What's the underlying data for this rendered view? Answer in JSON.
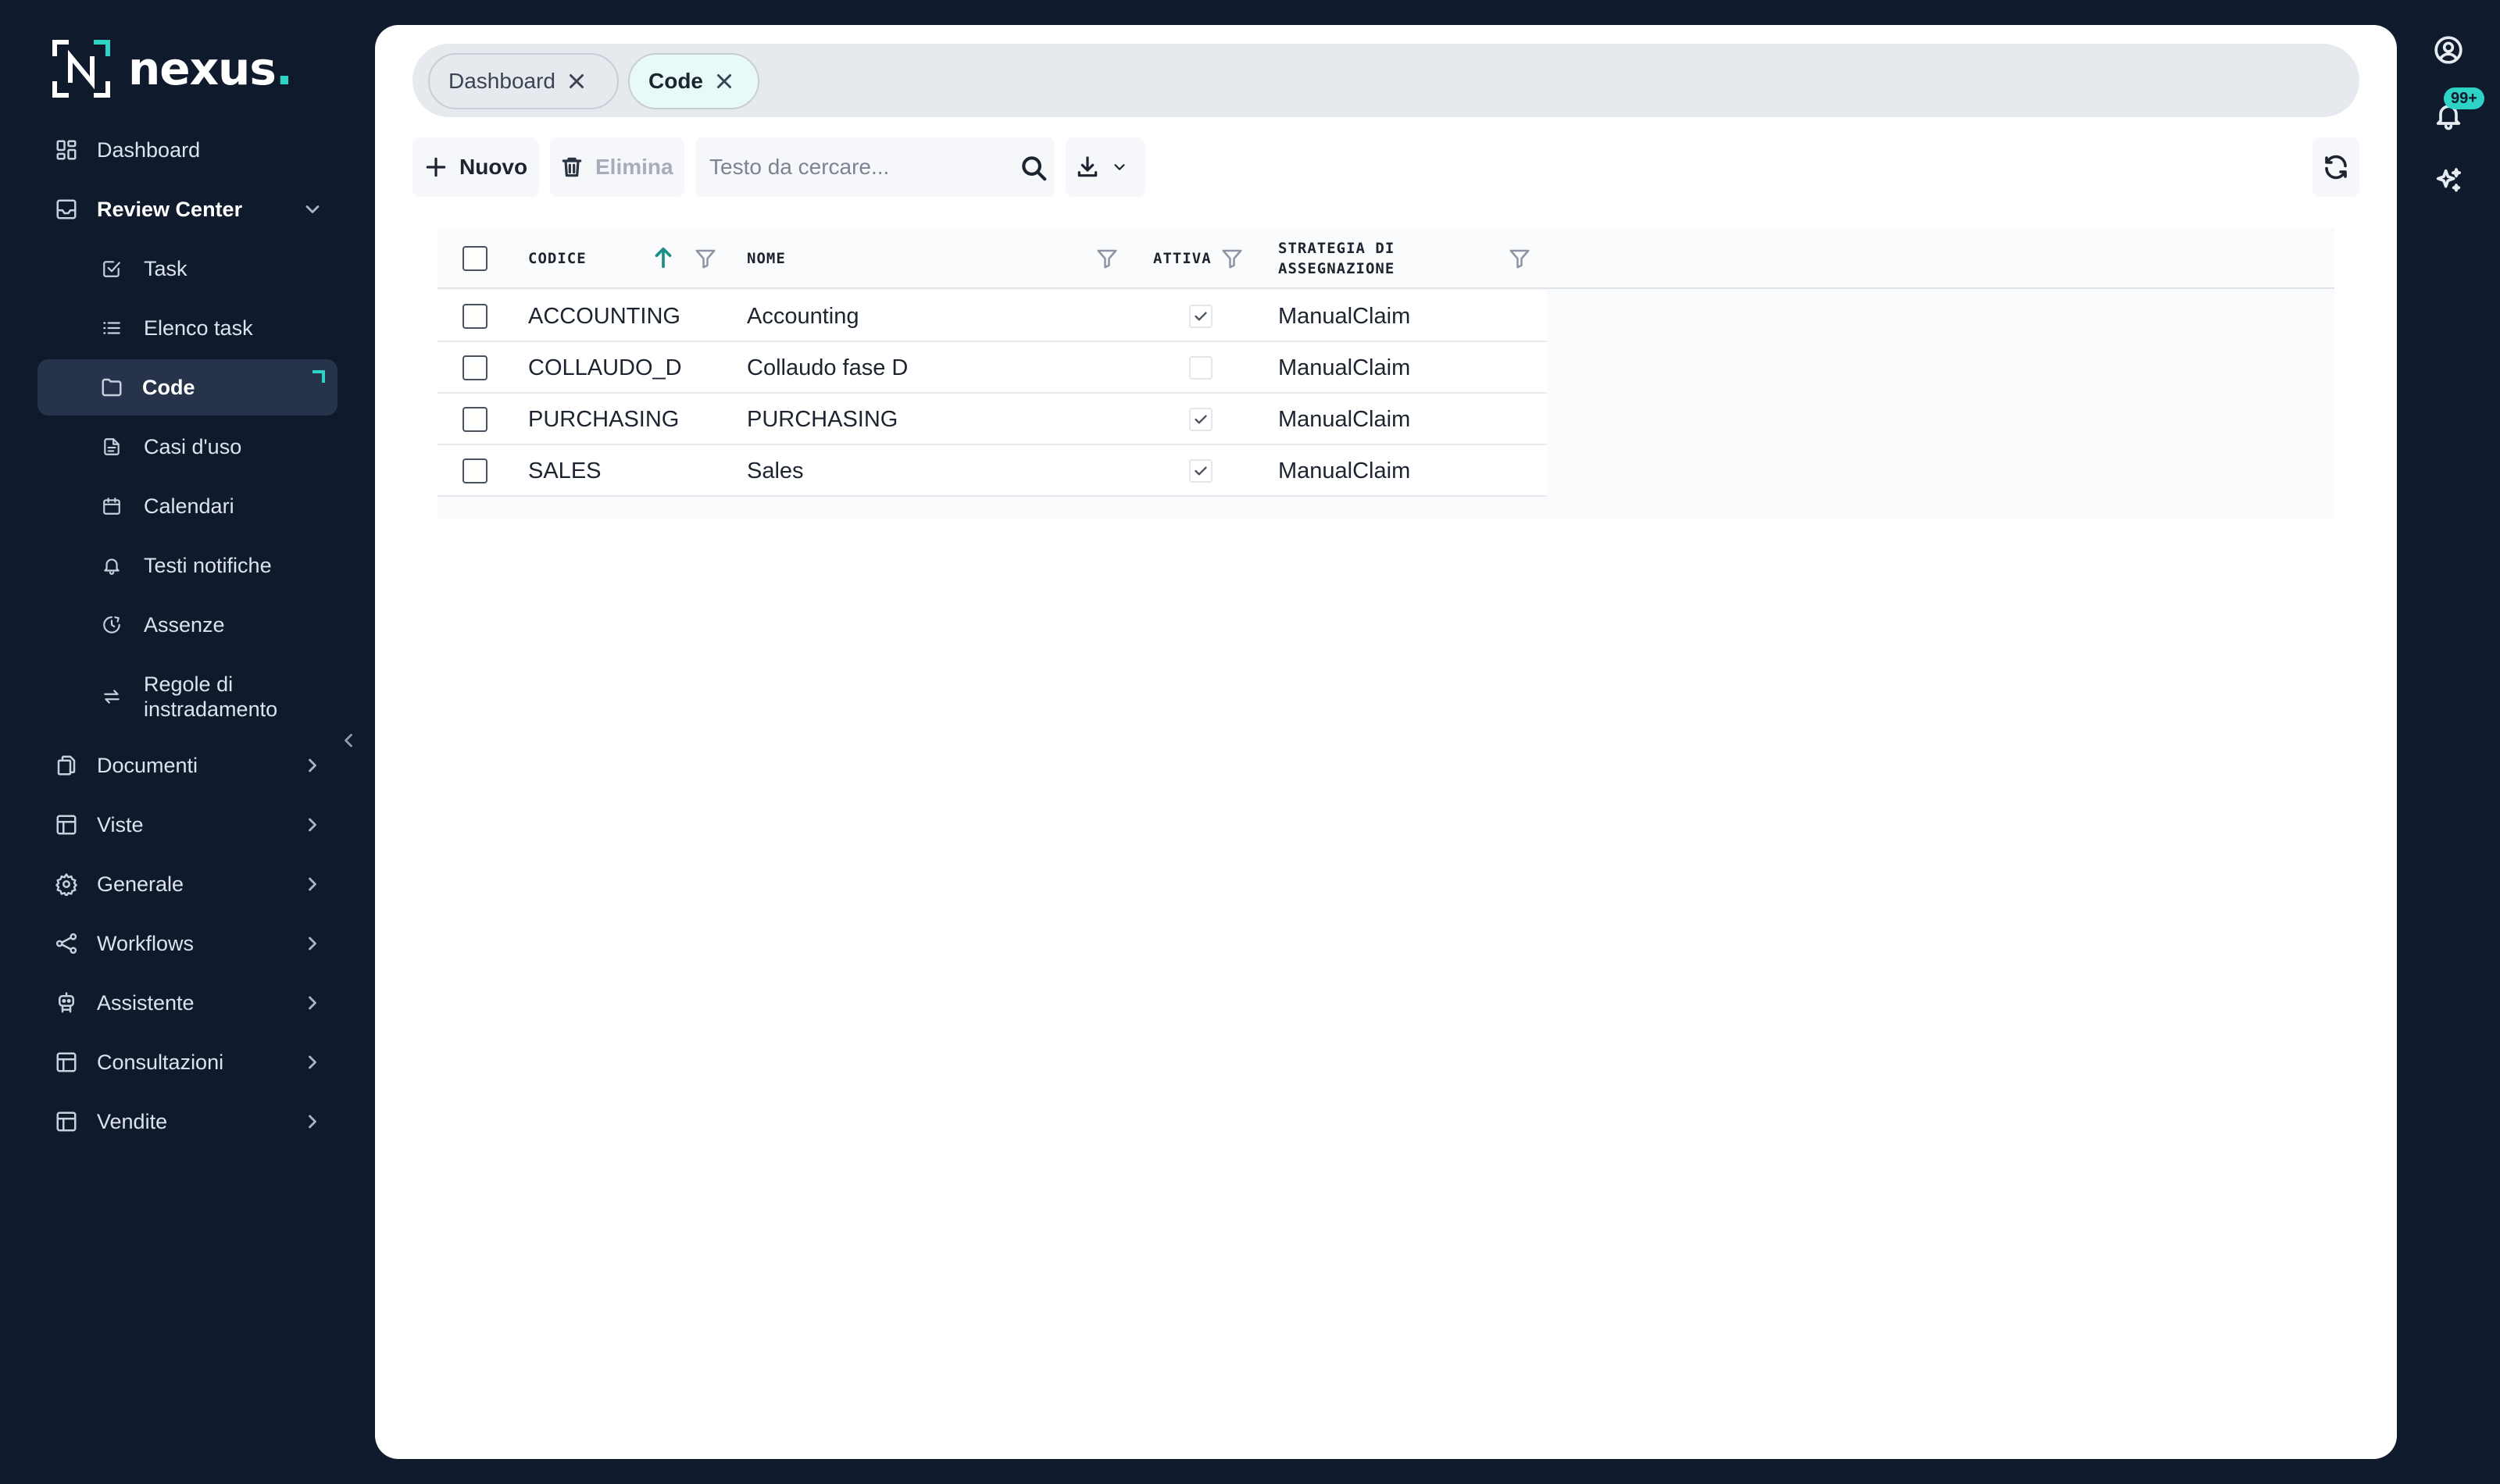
{
  "brand": {
    "name": "nexus",
    "dot": ".",
    "accent": "#2ed3c6"
  },
  "sidebar": {
    "items": [
      {
        "label": "Dashboard",
        "icon": "grid-icon"
      },
      {
        "label": "Review Center",
        "icon": "inbox-icon",
        "expanded": true
      },
      {
        "label": "Task",
        "icon": "checkbox-square-icon"
      },
      {
        "label": "Elenco task",
        "icon": "list-icon"
      },
      {
        "label": "Code",
        "icon": "folder-icon",
        "active": true
      },
      {
        "label": "Casi d'uso",
        "icon": "document-icon"
      },
      {
        "label": "Calendari",
        "icon": "calendar-icon"
      },
      {
        "label": "Testi notifiche",
        "icon": "bell-icon"
      },
      {
        "label": "Assenze",
        "icon": "clock-icon"
      },
      {
        "label": "Regole di",
        "label2": "instradamento",
        "icon": "arrows-swap-icon"
      },
      {
        "label": "Documenti",
        "icon": "files-icon"
      },
      {
        "label": "Viste",
        "icon": "table-icon"
      },
      {
        "label": "Generale",
        "icon": "gear-icon"
      },
      {
        "label": "Workflows",
        "icon": "share-nodes-icon"
      },
      {
        "label": "Assistente",
        "icon": "robot-icon"
      },
      {
        "label": "Consultazioni",
        "icon": "table-icon"
      },
      {
        "label": "Vendite",
        "icon": "table-icon"
      }
    ]
  },
  "tabs": [
    {
      "label": "Dashboard",
      "active": false
    },
    {
      "label": "Code",
      "active": true
    }
  ],
  "toolbar": {
    "new_label": "Nuovo",
    "delete_label": "Elimina",
    "search_placeholder": "Testo da cercare...",
    "search_value": ""
  },
  "table": {
    "columns": [
      {
        "label": "Codice",
        "sorted": "asc"
      },
      {
        "label": "Nome"
      },
      {
        "label": "Attiva"
      },
      {
        "label": "Strategia di",
        "label2": "assegnazione"
      }
    ],
    "rows": [
      {
        "codice": "ACCOUNTING",
        "nome": "Accounting",
        "attiva": true,
        "strategia": "ManualClaim"
      },
      {
        "codice": "COLLAUDO_D",
        "nome": "Collaudo fase D",
        "attiva": false,
        "strategia": "ManualClaim"
      },
      {
        "codice": "PURCHASING",
        "nome": "PURCHASING",
        "attiva": true,
        "strategia": "ManualClaim"
      },
      {
        "codice": "SALES",
        "nome": "Sales",
        "attiva": true,
        "strategia": "ManualClaim"
      }
    ]
  },
  "rail": {
    "notifications_badge": "99+"
  },
  "colors": {
    "sidebar_bg": "#0f1b2d",
    "active_item_bg": "#26334a",
    "accent": "#2ed3c6",
    "sort_arrow": "#1b8e85"
  }
}
